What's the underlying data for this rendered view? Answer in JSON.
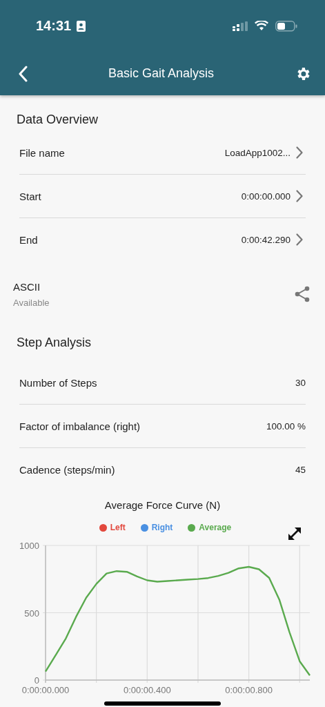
{
  "status_bar": {
    "time": "14:31"
  },
  "header": {
    "title": "Basic Gait Analysis"
  },
  "data_overview": {
    "title": "Data Overview",
    "rows": [
      {
        "label": "File name",
        "value": "LoadApp1002..."
      },
      {
        "label": "Start",
        "value": "0:00:00.000"
      },
      {
        "label": "End",
        "value": "0:00:42.290"
      }
    ]
  },
  "export": {
    "format": "ASCII",
    "status": "Available"
  },
  "step_analysis": {
    "title": "Step Analysis",
    "rows": [
      {
        "label": "Number of Steps",
        "value": "30"
      },
      {
        "label": "Factor of imbalance (right)",
        "value": "100.00 %"
      },
      {
        "label": "Cadence (steps/min)",
        "value": "45"
      }
    ]
  },
  "chart": {
    "chart_data": {
      "type": "line",
      "title": "Average Force Curve (N)",
      "categories": [
        "0:00:00.000",
        null,
        null,
        null,
        null,
        null,
        null,
        null,
        null,
        null,
        "0:00:00.400",
        null,
        null,
        null,
        null,
        null,
        null,
        null,
        null,
        null,
        "0:00:00.800",
        null,
        null,
        null,
        null,
        null,
        null
      ],
      "series": [
        {
          "name": "Left",
          "color": "#e2483d",
          "values": [
            null,
            null,
            null,
            null,
            null,
            null,
            null,
            null,
            null,
            null,
            null,
            null,
            null,
            null,
            null,
            null,
            null,
            null,
            null,
            null,
            null,
            null,
            null,
            null,
            null,
            null,
            null
          ]
        },
        {
          "name": "Right",
          "color": "#4a90e2",
          "values": [
            null,
            null,
            null,
            null,
            null,
            null,
            null,
            null,
            null,
            null,
            null,
            null,
            null,
            null,
            null,
            null,
            null,
            null,
            null,
            null,
            null,
            null,
            null,
            null,
            null,
            null,
            null
          ]
        },
        {
          "name": "Average",
          "color": "#5aaa4e",
          "values": [
            63,
            185,
            310,
            470,
            612,
            715,
            792,
            809,
            804,
            770,
            741,
            731,
            736,
            741,
            746,
            751,
            758,
            774,
            797,
            830,
            841,
            823,
            759,
            598,
            356,
            140,
            35
          ]
        }
      ],
      "grid": true,
      "ylim": [
        0,
        1000
      ],
      "yticks": [
        0,
        500,
        1000
      ]
    }
  }
}
